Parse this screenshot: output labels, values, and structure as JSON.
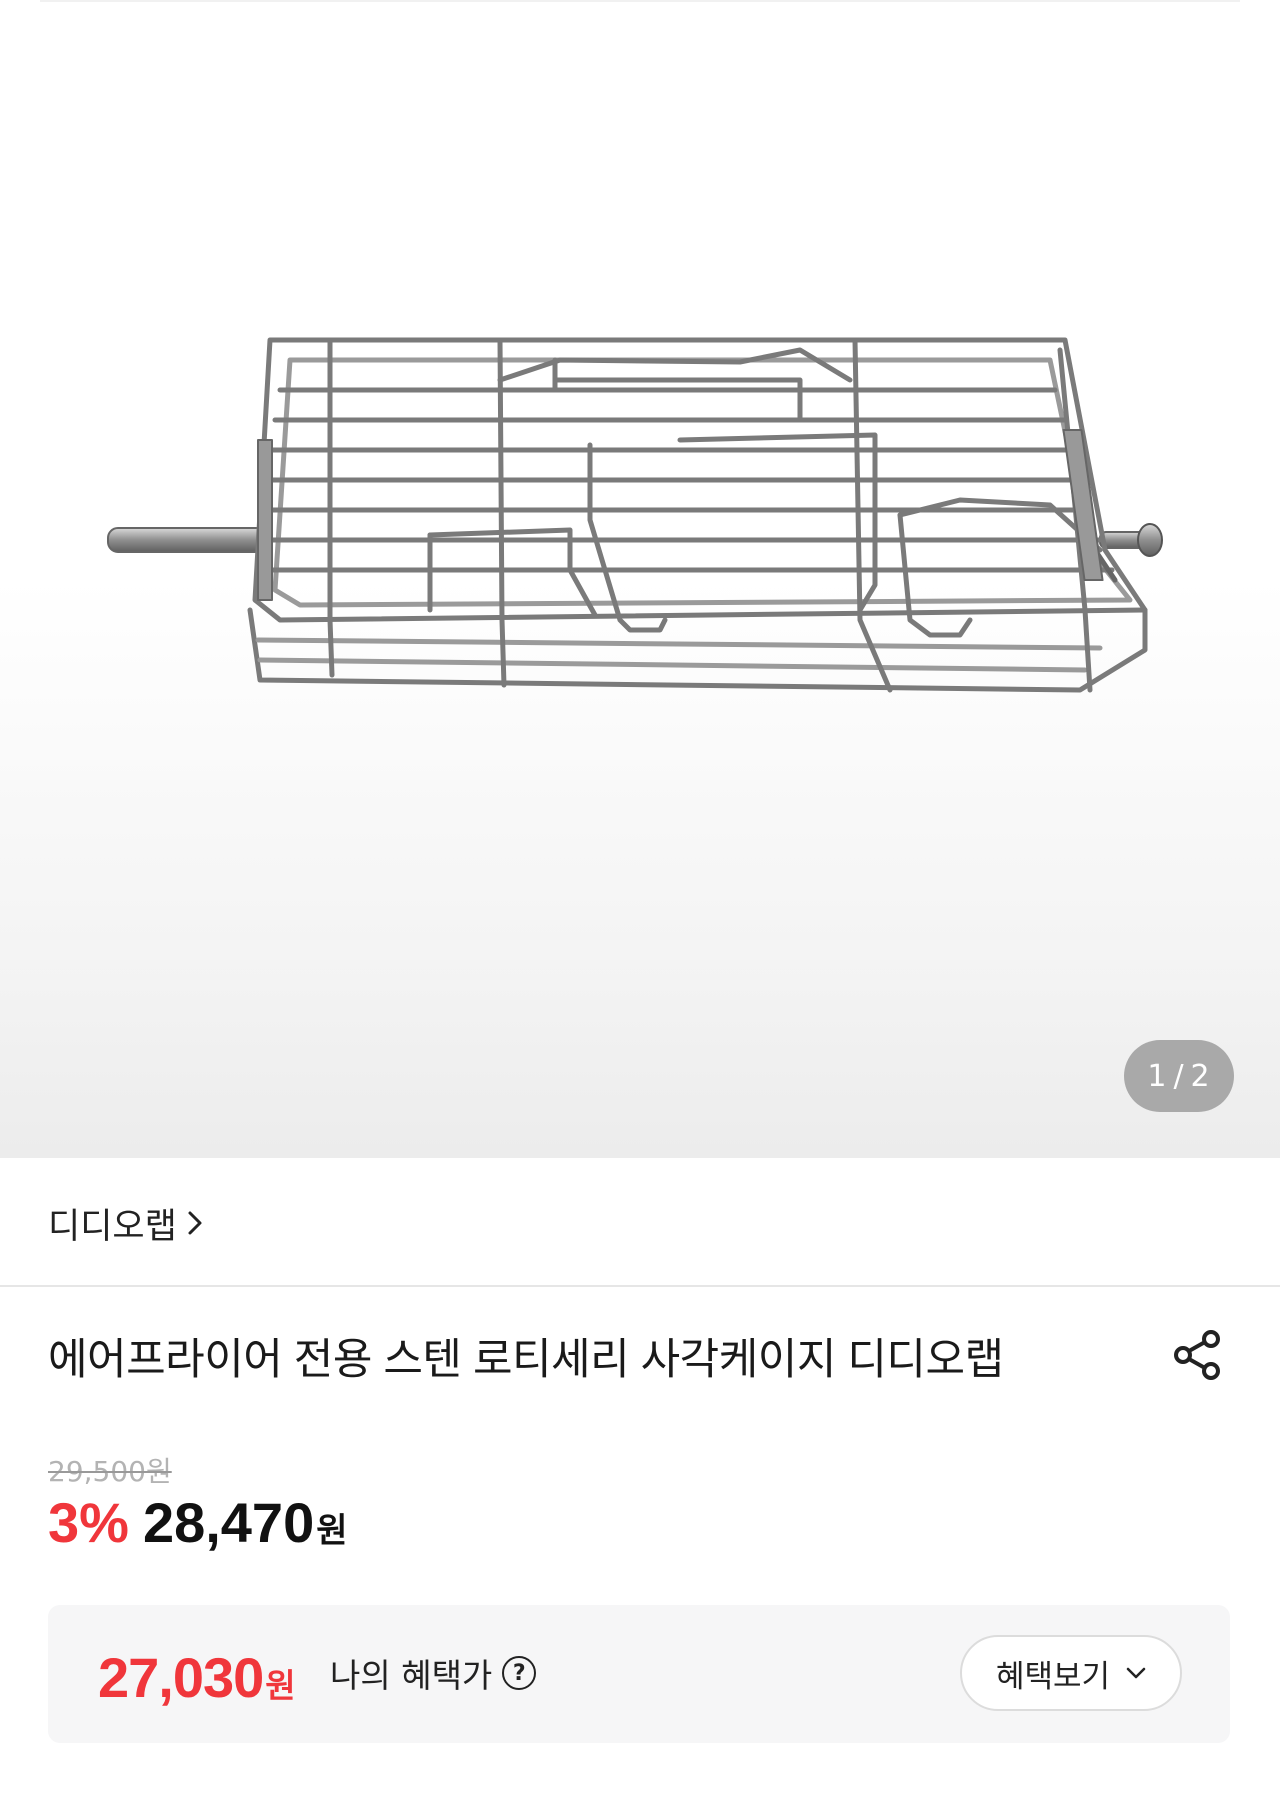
{
  "gallery": {
    "current_page": "1",
    "separator": "/",
    "total_pages": "2",
    "image_alt": "stainless steel rotisserie rectangular cage"
  },
  "brand": {
    "name": "디디오랩",
    "chevron_icon": "chevron-right-icon"
  },
  "product": {
    "title": "에어프라이어 전용 스텐 로티세리 사각케이지 디디오랩",
    "share_icon": "share-icon"
  },
  "pricing": {
    "original_price": "29,500원",
    "discount_rate": "3%",
    "sale_price": "28,470",
    "sale_unit": "원"
  },
  "benefit": {
    "price": "27,030",
    "unit": "원",
    "label": "나의 혜택가",
    "help_icon": "question-circle-icon",
    "button_label": "혜택보기",
    "button_icon": "chevron-down-icon"
  },
  "colors": {
    "accent_red": "#f0363b",
    "indicator_bg": "#a9a9a9",
    "benefit_bg": "#f6f6f7"
  }
}
